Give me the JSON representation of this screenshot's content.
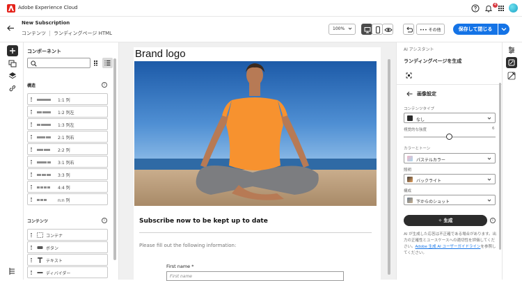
{
  "app": {
    "name": "Adobe Experience Cloud",
    "notification_count": "4"
  },
  "header": {
    "title": "New Subscription",
    "breadcrumb": [
      "コンテンツ",
      "ランディングページ HTML"
    ],
    "zoom": "100%",
    "more_label": "その他",
    "save_label": "保存して閉じる"
  },
  "components": {
    "title": "コンポーネント",
    "structure_label": "構造",
    "structure_items": [
      "1:1 列",
      "1:2 列左",
      "1:3 列左",
      "2:1 列右",
      "2:2 列",
      "3:1 列右",
      "3:3 列",
      "4:4 列",
      "n:n 列"
    ],
    "content_label": "コンテンツ",
    "content_items": [
      "コンテナ",
      "ボタン",
      "テキスト",
      "ディバイダー"
    ]
  },
  "canvas": {
    "brand_logo": "Brand logo",
    "subscribe_title": "Subscribe now to be kept up to date",
    "fill_text": "Please fill out the following information:",
    "first_name_label": "First name *",
    "first_name_placeholder": "First name"
  },
  "ai_panel": {
    "label": "AI アシスタント",
    "heading": "ランディングページを生成",
    "section_title": "画像設定",
    "content_type_label": "コンテンツタイプ",
    "content_type_value": "なし",
    "visual_intensity_label": "視覚的な強度",
    "visual_intensity_value": "6",
    "color_tone_label": "カラーとトーン",
    "color_tone_value": "パステルカラー",
    "lighting_label": "照明",
    "lighting_value": "バックライト",
    "composition_label": "構成",
    "composition_value": "下からのショット",
    "generate_label": "生成",
    "disclaimer_pre": "AI が生成した応答は不正確である場合があります。出力の正確性とユースケースへの適切性を評価してください。",
    "disclaimer_link": "Adobe 生成 AI ユーザーガイドライン",
    "disclaimer_post": "を参照してください。"
  },
  "colors": {
    "accent": "#1473e6",
    "adobe_red": "#e5231b",
    "dark": "#2c2c2c"
  }
}
